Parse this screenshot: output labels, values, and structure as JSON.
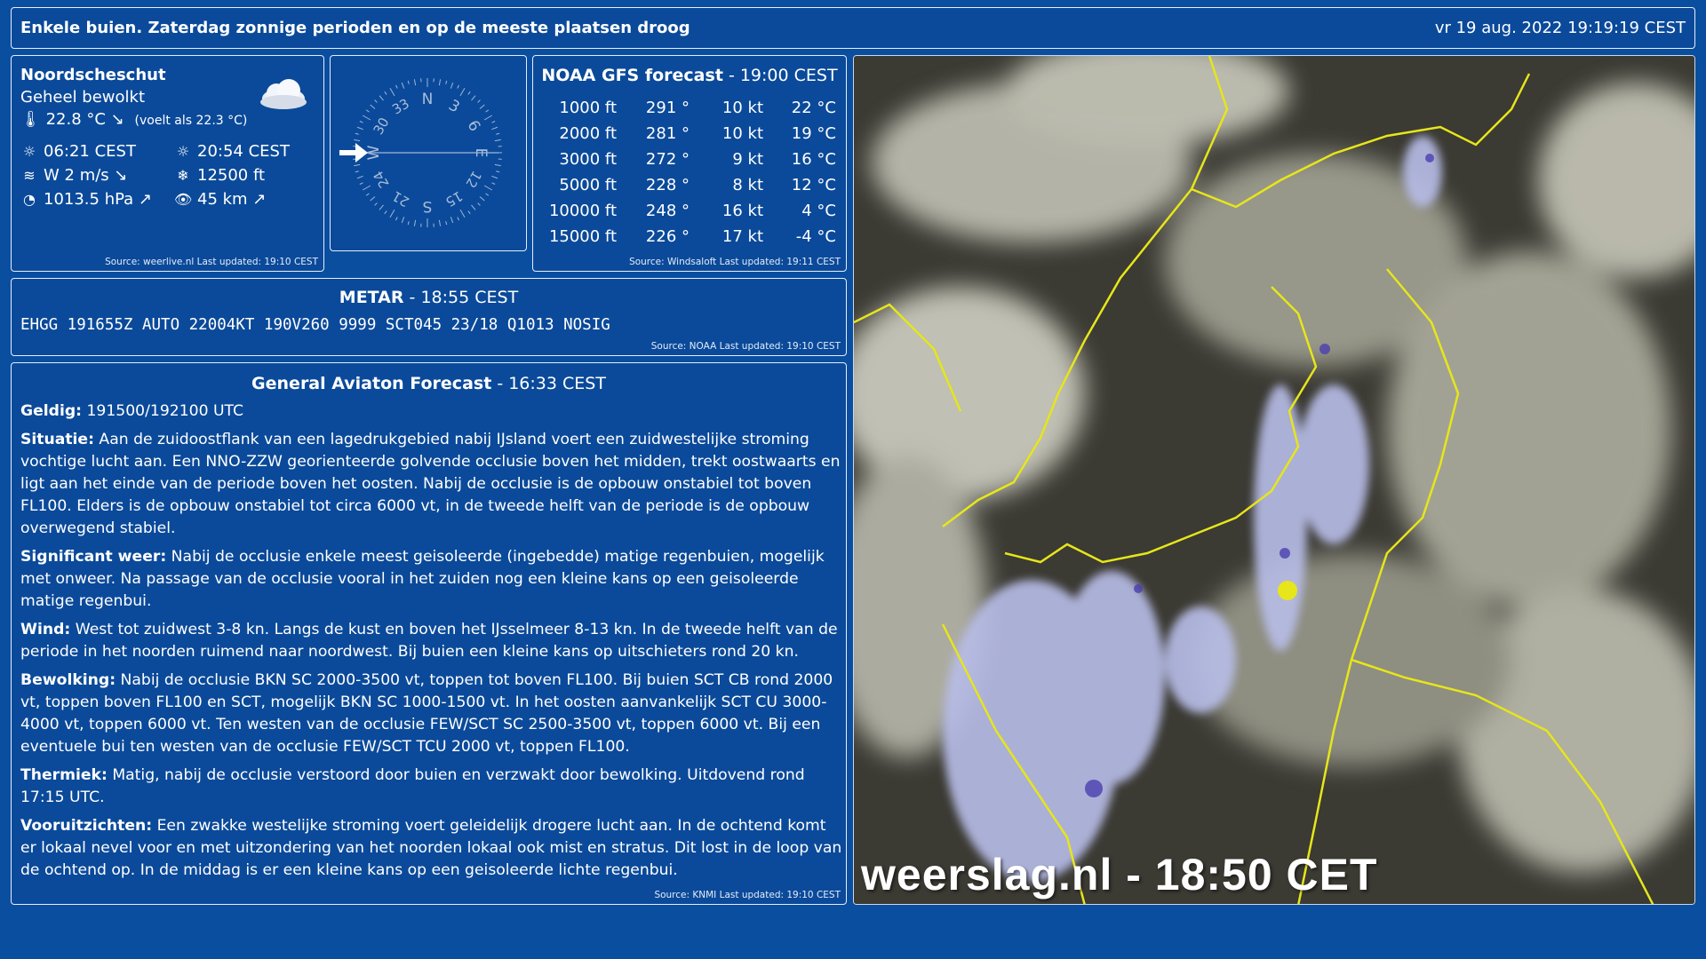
{
  "header": {
    "headline": "Enkele buien. Zaterdag zonnige perioden en op de meeste plaatsen droog",
    "datetime": "vr 19 aug. 2022 19:19:19 CEST"
  },
  "current": {
    "station": "Noordscheschut",
    "condition": "Geheel bewolkt",
    "temperature": "22.8 °C",
    "feels_like": "(voelt als 22.3 °C)",
    "sunrise": "06:21 CEST",
    "sunset": "20:54 CEST",
    "wind": "W 2 m/s",
    "cloud_base": "12500 ft",
    "pressure": "1013.5 hPa",
    "visibility": "45 km",
    "source": "Source: weerlive.nl Last updated: 19:10 CEST",
    "icons": [
      "cloud-icon",
      "thermometer-icon",
      "sunrise-icon",
      "sunset-icon",
      "wind-icon",
      "snowflake-icon",
      "gauge-icon",
      "eye-icon"
    ]
  },
  "compass": {
    "labels": [
      "N",
      "3",
      "6",
      "E",
      "12",
      "15",
      "S",
      "21",
      "24",
      "W",
      "30",
      "33"
    ],
    "wind_from_deg": 270
  },
  "gfs": {
    "title": "NOAA GFS forecast",
    "time": " - 19:00 CEST",
    "rows": [
      [
        "1000 ft",
        "291 °",
        "10 kt",
        "22 °C"
      ],
      [
        "2000 ft",
        "281 °",
        "10 kt",
        "19 °C"
      ],
      [
        "3000 ft",
        "272 °",
        "9 kt",
        "16 °C"
      ],
      [
        "5000 ft",
        "228 °",
        "8 kt",
        "12 °C"
      ],
      [
        "10000 ft",
        "248 °",
        "16 kt",
        "4 °C"
      ],
      [
        "15000 ft",
        "226 °",
        "17 kt",
        "-4 °C"
      ]
    ],
    "source": "Source: Windsaloft Last updated: 19:11 CEST"
  },
  "metar": {
    "title": "METAR",
    "time": " - 18:55 CEST",
    "code": "EHGG 191655Z AUTO 22004KT 190V260 9999 SCT045 23/18 Q1013 NOSIG",
    "source": "Source: NOAA Last updated: 19:10 CEST"
  },
  "gaf": {
    "title": "General Aviaton Forecast",
    "time": " - 16:33 CEST",
    "sections": [
      {
        "label": "Geldig:",
        "text": " 191500/192100 UTC"
      },
      {
        "label": "Situatie:",
        "text": " Aan de zuidoostflank van een lagedrukgebied nabij IJsland voert een zuidwestelijke stroming vochtige lucht aan. Een NNO-ZZW georienteerde golvende occlusie boven het midden, trekt oostwaarts en ligt aan het einde van de periode boven het oosten. Nabij de occlusie is de opbouw onstabiel tot boven FL100. Elders is de opbouw onstabiel tot circa 6000 vt, in de tweede helft van de periode is de opbouw overwegend stabiel."
      },
      {
        "label": "Significant weer:",
        "text": " Nabij de occlusie enkele meest geisoleerde (ingebedde) matige regenbuien, mogelijk met onweer. Na passage van de occlusie vooral in het zuiden nog een kleine kans op een geisoleerde matige regenbui."
      },
      {
        "label": "Wind:",
        "text": " West tot zuidwest 3-8 kn. Langs de kust en boven het IJsselmeer 8-13 kn. In de tweede helft van de periode in het noorden ruimend naar noordwest. Bij buien een kleine kans op uitschieters rond 20 kn."
      },
      {
        "label": "Bewolking:",
        "text": " Nabij de occlusie BKN SC 2000-3500 vt, toppen tot boven FL100. Bij buien SCT CB rond 2000 vt, toppen boven FL100 en SCT, mogelijk BKN SC 1000-1500 vt. In het oosten aanvankelijk SCT CU 3000-4000 vt, toppen 6000 vt. Ten westen van de occlusie FEW/SCT SC 2500-3500 vt, toppen 6000 vt. Bij een eventuele bui ten westen van de occlusie FEW/SCT TCU 2000 vt, toppen FL100."
      },
      {
        "label": "Thermiek:",
        "text": " Matig, nabij de occlusie verstoord door buien en verzwakt door bewolking. Uitdovend rond 17:15 UTC."
      },
      {
        "label": "Vooruitzichten:",
        "text": " Een zwakke westelijke stroming voert geleidelijk drogere lucht aan. In de ochtend komt er lokaal nevel voor en met uitzondering van het noorden lokaal ook mist en stratus. Dit lost in de loop van de ochtend op. In de middag is er een kleine kans op een geisoleerde lichte regenbui."
      }
    ],
    "source": "Source: KNMI Last updated: 19:10 CEST"
  },
  "satellite": {
    "caption": "weerslag.nl - 18:50 CET"
  }
}
